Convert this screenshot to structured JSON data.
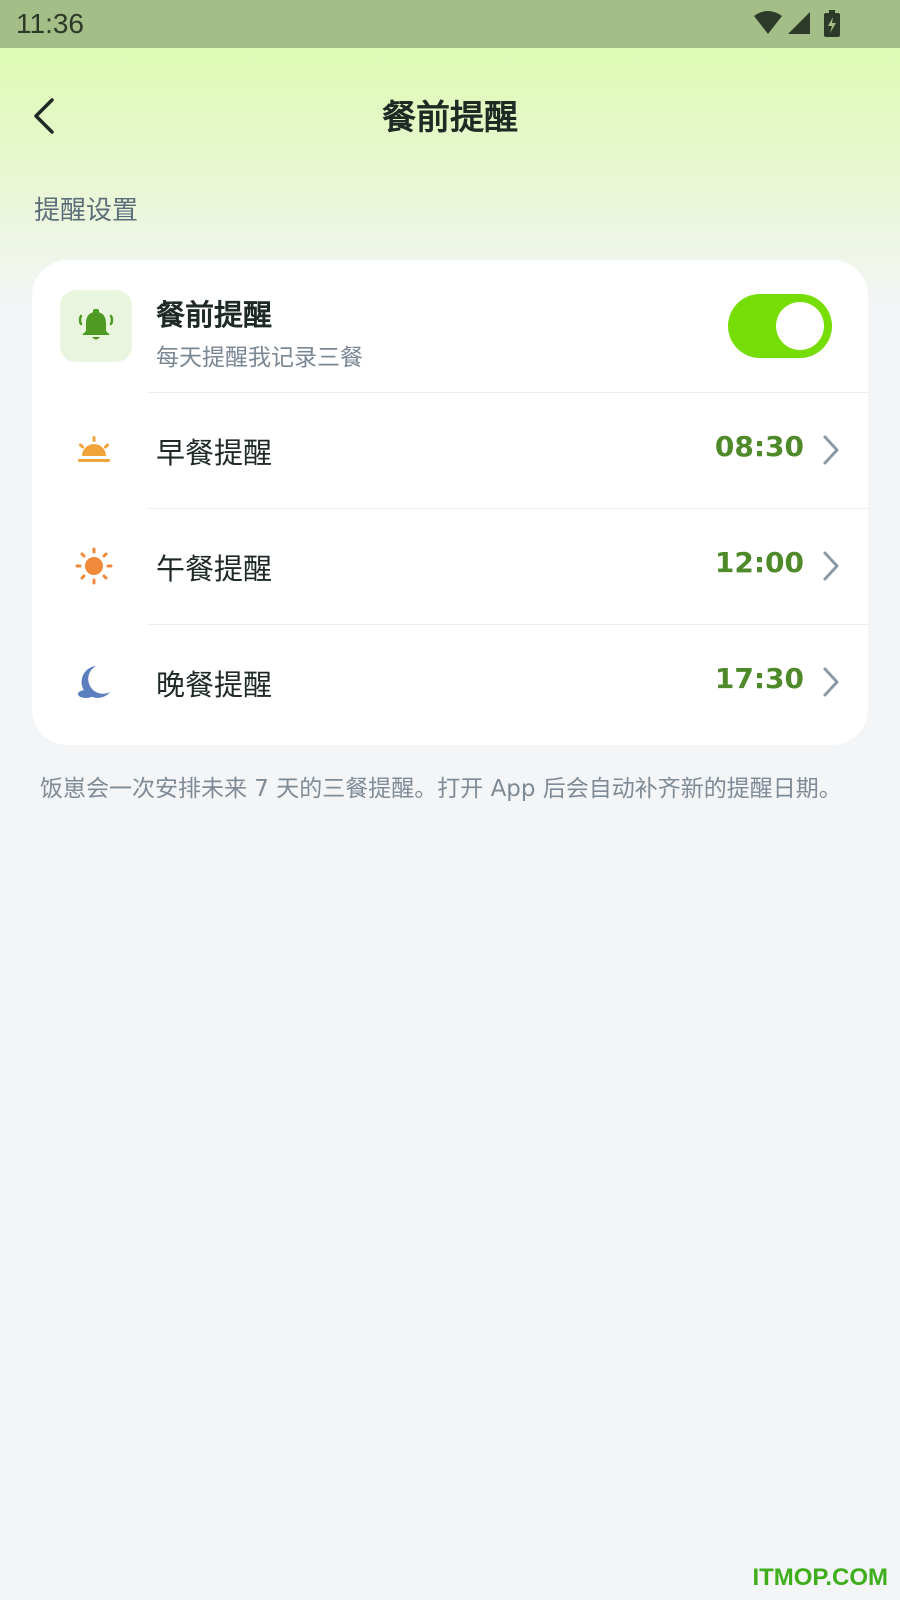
{
  "status_bar": {
    "time": "11:36",
    "icons": [
      "wifi-icon",
      "signal-icon",
      "battery-charging-icon"
    ]
  },
  "header": {
    "title": "餐前提醒",
    "back_icon": "chevron-left-icon"
  },
  "section": {
    "label": "提醒设置"
  },
  "master": {
    "title": "餐前提醒",
    "subtitle": "每天提醒我记录三餐",
    "enabled": true,
    "icon": "bell-icon",
    "accent": "#77dd07"
  },
  "meals": [
    {
      "label": "早餐提醒",
      "time": "08:30",
      "icon": "sunrise-icon",
      "color": "#f0a43a"
    },
    {
      "label": "午餐提醒",
      "time": "12:00",
      "icon": "sun-icon",
      "color": "#f08a3a"
    },
    {
      "label": "晚餐提醒",
      "time": "17:30",
      "icon": "moon-icon",
      "color": "#5b7fbf"
    }
  ],
  "footnote": "饭崽会一次安排未来 7 天的三餐提醒。打开 App 后会自动补齐新的提醒日期。",
  "watermark": "ITMOP.COM"
}
